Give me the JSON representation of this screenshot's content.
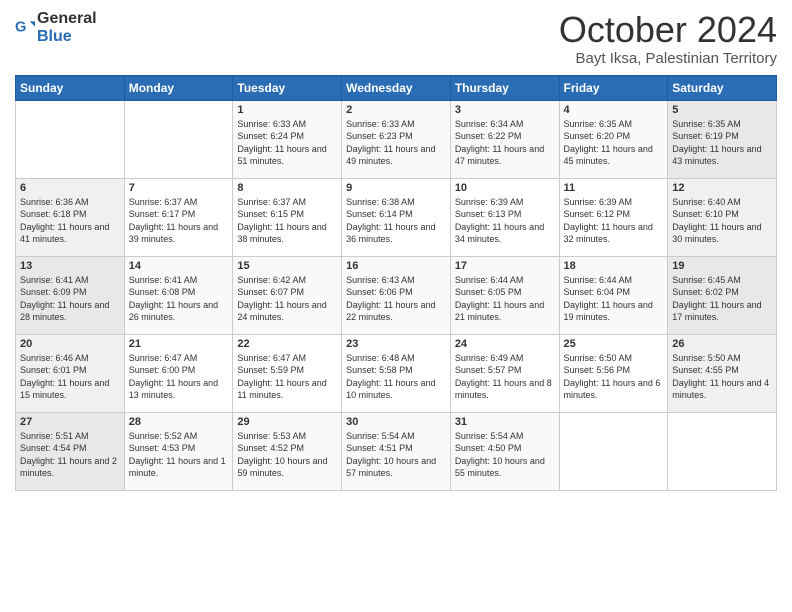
{
  "logo": {
    "general": "General",
    "blue": "Blue"
  },
  "title": "October 2024",
  "location": "Bayt Iksa, Palestinian Territory",
  "days_of_week": [
    "Sunday",
    "Monday",
    "Tuesday",
    "Wednesday",
    "Thursday",
    "Friday",
    "Saturday"
  ],
  "weeks": [
    [
      {
        "day": "",
        "sunrise": "",
        "sunset": "",
        "daylight": ""
      },
      {
        "day": "",
        "sunrise": "",
        "sunset": "",
        "daylight": ""
      },
      {
        "day": "1",
        "sunrise": "Sunrise: 6:33 AM",
        "sunset": "Sunset: 6:24 PM",
        "daylight": "Daylight: 11 hours and 51 minutes."
      },
      {
        "day": "2",
        "sunrise": "Sunrise: 6:33 AM",
        "sunset": "Sunset: 6:23 PM",
        "daylight": "Daylight: 11 hours and 49 minutes."
      },
      {
        "day": "3",
        "sunrise": "Sunrise: 6:34 AM",
        "sunset": "Sunset: 6:22 PM",
        "daylight": "Daylight: 11 hours and 47 minutes."
      },
      {
        "day": "4",
        "sunrise": "Sunrise: 6:35 AM",
        "sunset": "Sunset: 6:20 PM",
        "daylight": "Daylight: 11 hours and 45 minutes."
      },
      {
        "day": "5",
        "sunrise": "Sunrise: 6:35 AM",
        "sunset": "Sunset: 6:19 PM",
        "daylight": "Daylight: 11 hours and 43 minutes."
      }
    ],
    [
      {
        "day": "6",
        "sunrise": "Sunrise: 6:36 AM",
        "sunset": "Sunset: 6:18 PM",
        "daylight": "Daylight: 11 hours and 41 minutes."
      },
      {
        "day": "7",
        "sunrise": "Sunrise: 6:37 AM",
        "sunset": "Sunset: 6:17 PM",
        "daylight": "Daylight: 11 hours and 39 minutes."
      },
      {
        "day": "8",
        "sunrise": "Sunrise: 6:37 AM",
        "sunset": "Sunset: 6:15 PM",
        "daylight": "Daylight: 11 hours and 38 minutes."
      },
      {
        "day": "9",
        "sunrise": "Sunrise: 6:38 AM",
        "sunset": "Sunset: 6:14 PM",
        "daylight": "Daylight: 11 hours and 36 minutes."
      },
      {
        "day": "10",
        "sunrise": "Sunrise: 6:39 AM",
        "sunset": "Sunset: 6:13 PM",
        "daylight": "Daylight: 11 hours and 34 minutes."
      },
      {
        "day": "11",
        "sunrise": "Sunrise: 6:39 AM",
        "sunset": "Sunset: 6:12 PM",
        "daylight": "Daylight: 11 hours and 32 minutes."
      },
      {
        "day": "12",
        "sunrise": "Sunrise: 6:40 AM",
        "sunset": "Sunset: 6:10 PM",
        "daylight": "Daylight: 11 hours and 30 minutes."
      }
    ],
    [
      {
        "day": "13",
        "sunrise": "Sunrise: 6:41 AM",
        "sunset": "Sunset: 6:09 PM",
        "daylight": "Daylight: 11 hours and 28 minutes."
      },
      {
        "day": "14",
        "sunrise": "Sunrise: 6:41 AM",
        "sunset": "Sunset: 6:08 PM",
        "daylight": "Daylight: 11 hours and 26 minutes."
      },
      {
        "day": "15",
        "sunrise": "Sunrise: 6:42 AM",
        "sunset": "Sunset: 6:07 PM",
        "daylight": "Daylight: 11 hours and 24 minutes."
      },
      {
        "day": "16",
        "sunrise": "Sunrise: 6:43 AM",
        "sunset": "Sunset: 6:06 PM",
        "daylight": "Daylight: 11 hours and 22 minutes."
      },
      {
        "day": "17",
        "sunrise": "Sunrise: 6:44 AM",
        "sunset": "Sunset: 6:05 PM",
        "daylight": "Daylight: 11 hours and 21 minutes."
      },
      {
        "day": "18",
        "sunrise": "Sunrise: 6:44 AM",
        "sunset": "Sunset: 6:04 PM",
        "daylight": "Daylight: 11 hours and 19 minutes."
      },
      {
        "day": "19",
        "sunrise": "Sunrise: 6:45 AM",
        "sunset": "Sunset: 6:02 PM",
        "daylight": "Daylight: 11 hours and 17 minutes."
      }
    ],
    [
      {
        "day": "20",
        "sunrise": "Sunrise: 6:46 AM",
        "sunset": "Sunset: 6:01 PM",
        "daylight": "Daylight: 11 hours and 15 minutes."
      },
      {
        "day": "21",
        "sunrise": "Sunrise: 6:47 AM",
        "sunset": "Sunset: 6:00 PM",
        "daylight": "Daylight: 11 hours and 13 minutes."
      },
      {
        "day": "22",
        "sunrise": "Sunrise: 6:47 AM",
        "sunset": "Sunset: 5:59 PM",
        "daylight": "Daylight: 11 hours and 11 minutes."
      },
      {
        "day": "23",
        "sunrise": "Sunrise: 6:48 AM",
        "sunset": "Sunset: 5:58 PM",
        "daylight": "Daylight: 11 hours and 10 minutes."
      },
      {
        "day": "24",
        "sunrise": "Sunrise: 6:49 AM",
        "sunset": "Sunset: 5:57 PM",
        "daylight": "Daylight: 11 hours and 8 minutes."
      },
      {
        "day": "25",
        "sunrise": "Sunrise: 6:50 AM",
        "sunset": "Sunset: 5:56 PM",
        "daylight": "Daylight: 11 hours and 6 minutes."
      },
      {
        "day": "26",
        "sunrise": "Sunrise: 5:50 AM",
        "sunset": "Sunset: 4:55 PM",
        "daylight": "Daylight: 11 hours and 4 minutes."
      }
    ],
    [
      {
        "day": "27",
        "sunrise": "Sunrise: 5:51 AM",
        "sunset": "Sunset: 4:54 PM",
        "daylight": "Daylight: 11 hours and 2 minutes."
      },
      {
        "day": "28",
        "sunrise": "Sunrise: 5:52 AM",
        "sunset": "Sunset: 4:53 PM",
        "daylight": "Daylight: 11 hours and 1 minute."
      },
      {
        "day": "29",
        "sunrise": "Sunrise: 5:53 AM",
        "sunset": "Sunset: 4:52 PM",
        "daylight": "Daylight: 10 hours and 59 minutes."
      },
      {
        "day": "30",
        "sunrise": "Sunrise: 5:54 AM",
        "sunset": "Sunset: 4:51 PM",
        "daylight": "Daylight: 10 hours and 57 minutes."
      },
      {
        "day": "31",
        "sunrise": "Sunrise: 5:54 AM",
        "sunset": "Sunset: 4:50 PM",
        "daylight": "Daylight: 10 hours and 55 minutes."
      },
      {
        "day": "",
        "sunrise": "",
        "sunset": "",
        "daylight": ""
      },
      {
        "day": "",
        "sunrise": "",
        "sunset": "",
        "daylight": ""
      }
    ]
  ]
}
